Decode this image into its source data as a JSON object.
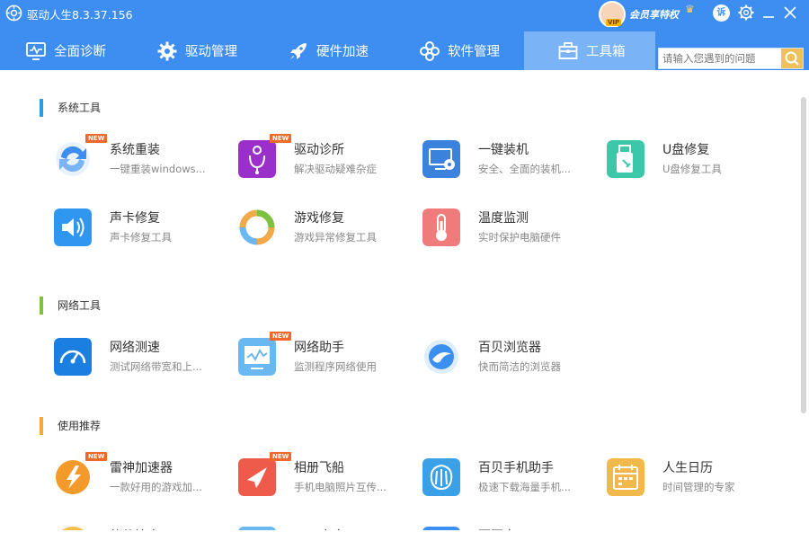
{
  "app": {
    "title": "驱动人生8.3.37.156"
  },
  "vip": {
    "label": "会员享特权",
    "tag": "VIP"
  },
  "titlebar": {
    "sue_label": "诉"
  },
  "nav": {
    "tabs": [
      {
        "label": "全面诊断",
        "icon": "monitor-check-icon"
      },
      {
        "label": "驱动管理",
        "icon": "gear-icon"
      },
      {
        "label": "硬件加速",
        "icon": "rocket-icon"
      },
      {
        "label": "软件管理",
        "icon": "flower-icon"
      },
      {
        "label": "工具箱",
        "icon": "toolbox-icon"
      }
    ]
  },
  "search": {
    "placeholder": "请输入您遇到的问题"
  },
  "sections": [
    {
      "title": "系统工具",
      "color": "#2e9be6",
      "tools": [
        {
          "name": "系统重装",
          "desc": "一键重装windows...",
          "new": "NEW",
          "color": "#3d8ef0"
        },
        {
          "name": "驱动诊所",
          "desc": "解决驱动疑难杂症",
          "new": "NEW",
          "color": "#9b2fc9"
        },
        {
          "name": "一键装机",
          "desc": "安全、全面的装机...",
          "new": "",
          "color": "#3a82dc"
        },
        {
          "name": "U盘修复",
          "desc": "U盘修复工具",
          "new": "",
          "color": "#3cc8a8"
        },
        {
          "name": "声卡修复",
          "desc": "声卡修复工具",
          "new": "",
          "color": "#2f97ef"
        },
        {
          "name": "游戏修复",
          "desc": "游戏异常修复工具",
          "new": "",
          "color": "#f1a94a"
        },
        {
          "name": "温度监测",
          "desc": "实时保护电脑硬件",
          "new": "",
          "color": "#f07b7b"
        }
      ]
    },
    {
      "title": "网络工具",
      "color": "#7cc242",
      "tools": [
        {
          "name": "网络测速",
          "desc": "测试网络带宽和上...",
          "new": "",
          "color": "#1a7fe0"
        },
        {
          "name": "网络助手",
          "desc": "监测程序网络使用",
          "new": "NEW",
          "color": "#6ab8f2"
        },
        {
          "name": "百贝浏览器",
          "desc": "快而简洁的浏览器",
          "new": "",
          "color": "#3a8ff0"
        }
      ]
    },
    {
      "title": "使用推荐",
      "color": "#f2a93a",
      "tools": [
        {
          "name": "雷神加速器",
          "desc": "一款好用的游戏加...",
          "new": "NEW",
          "color": "#f39a2a"
        },
        {
          "name": "相册飞船",
          "desc": "手机电脑照片互传...",
          "new": "NEW",
          "color": "#ef5b4b"
        },
        {
          "name": "百贝手机助手",
          "desc": "极速下载海量手机...",
          "new": "",
          "color": "#3aa0e8"
        },
        {
          "name": "人生日历",
          "desc": "时间管理的专家",
          "new": "",
          "color": "#f1b94c"
        }
      ]
    }
  ],
  "partial_row": [
    "软件管家",
    "USB安全",
    "百页窗"
  ]
}
